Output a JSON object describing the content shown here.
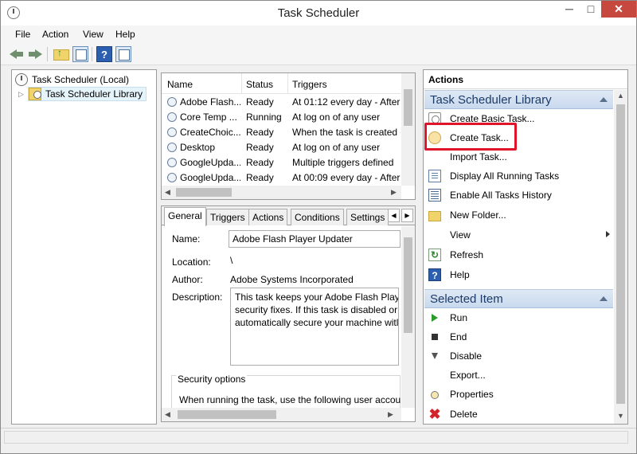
{
  "window": {
    "title": "Task Scheduler",
    "minimize": "─",
    "maximize": "□",
    "close": "✕"
  },
  "menu": [
    "File",
    "Action",
    "View",
    "Help"
  ],
  "toolbar": {
    "icons": [
      "back-arrow-icon",
      "forward-arrow-icon",
      "folder-up-icon",
      "show-hide-console-tree-icon",
      "help-icon",
      "show-hide-action-pane-icon"
    ],
    "help_glyph": "?"
  },
  "tree": {
    "root": "Task Scheduler (Local)",
    "child": "Task Scheduler Library",
    "expander": "▷"
  },
  "task_list": {
    "columns": [
      "Name",
      "Status",
      "Triggers"
    ],
    "rows": [
      {
        "name": "Adobe Flash...",
        "status": "Ready",
        "trigger": "At 01:12 every day - After t"
      },
      {
        "name": "Core Temp ...",
        "status": "Running",
        "trigger": "At log on of any user"
      },
      {
        "name": "CreateChoic...",
        "status": "Ready",
        "trigger": "When the task is created o"
      },
      {
        "name": "Desktop",
        "status": "Ready",
        "trigger": "At log on of any user"
      },
      {
        "name": "GoogleUpda...",
        "status": "Ready",
        "trigger": "Multiple triggers defined"
      },
      {
        "name": "GoogleUpda...",
        "status": "Ready",
        "trigger": "At 00:09 every day - After t"
      }
    ]
  },
  "details": {
    "tabs": [
      "General",
      "Triggers",
      "Actions",
      "Conditions",
      "Settings"
    ],
    "tab_nav": [
      "◀",
      "▶"
    ],
    "labels": {
      "name": "Name:",
      "location": "Location:",
      "author": "Author:",
      "description": "Description:"
    },
    "name_value": "Adobe Flash Player Updater",
    "location_value": "\\",
    "author_value": "Adobe Systems Incorporated",
    "description_lines": [
      "This task keeps your Adobe Flash Playe",
      "security fixes. If this task is disabled or r",
      "automatically secure your machine witl"
    ],
    "security_options": "Security options",
    "security_text": "When running the task, use the following user accou"
  },
  "actions": {
    "title": "Actions",
    "library_section": "Task Scheduler Library",
    "library_items": [
      {
        "label": "Create Basic Task...",
        "icon": "create-basic-task-icon"
      },
      {
        "label": "Create Task...",
        "icon": "create-task-icon"
      },
      {
        "label": "Import Task...",
        "icon": "import-task-icon"
      },
      {
        "label": "Display All Running Tasks",
        "icon": "running-tasks-icon"
      },
      {
        "label": "Enable All Tasks History",
        "icon": "tasks-history-icon"
      },
      {
        "label": "New Folder...",
        "icon": "new-folder-icon"
      },
      {
        "label": "View",
        "icon": "none"
      },
      {
        "label": "Refresh",
        "icon": "refresh-icon"
      },
      {
        "label": "Help",
        "icon": "help-icon"
      }
    ],
    "selected_section": "Selected Item",
    "selected_items": [
      {
        "label": "Run",
        "icon": "run-icon"
      },
      {
        "label": "End",
        "icon": "end-icon"
      },
      {
        "label": "Disable",
        "icon": "disable-icon"
      },
      {
        "label": "Export...",
        "icon": "export-icon"
      },
      {
        "label": "Properties",
        "icon": "properties-icon"
      },
      {
        "label": "Delete",
        "icon": "delete-icon"
      }
    ],
    "refresh_glyph": "↻",
    "help_glyph": "?",
    "delete_glyph": "✖"
  },
  "colors": {
    "highlight": "#e0142a",
    "section_header": "#c9d9ee",
    "close_button": "#c7483f"
  }
}
